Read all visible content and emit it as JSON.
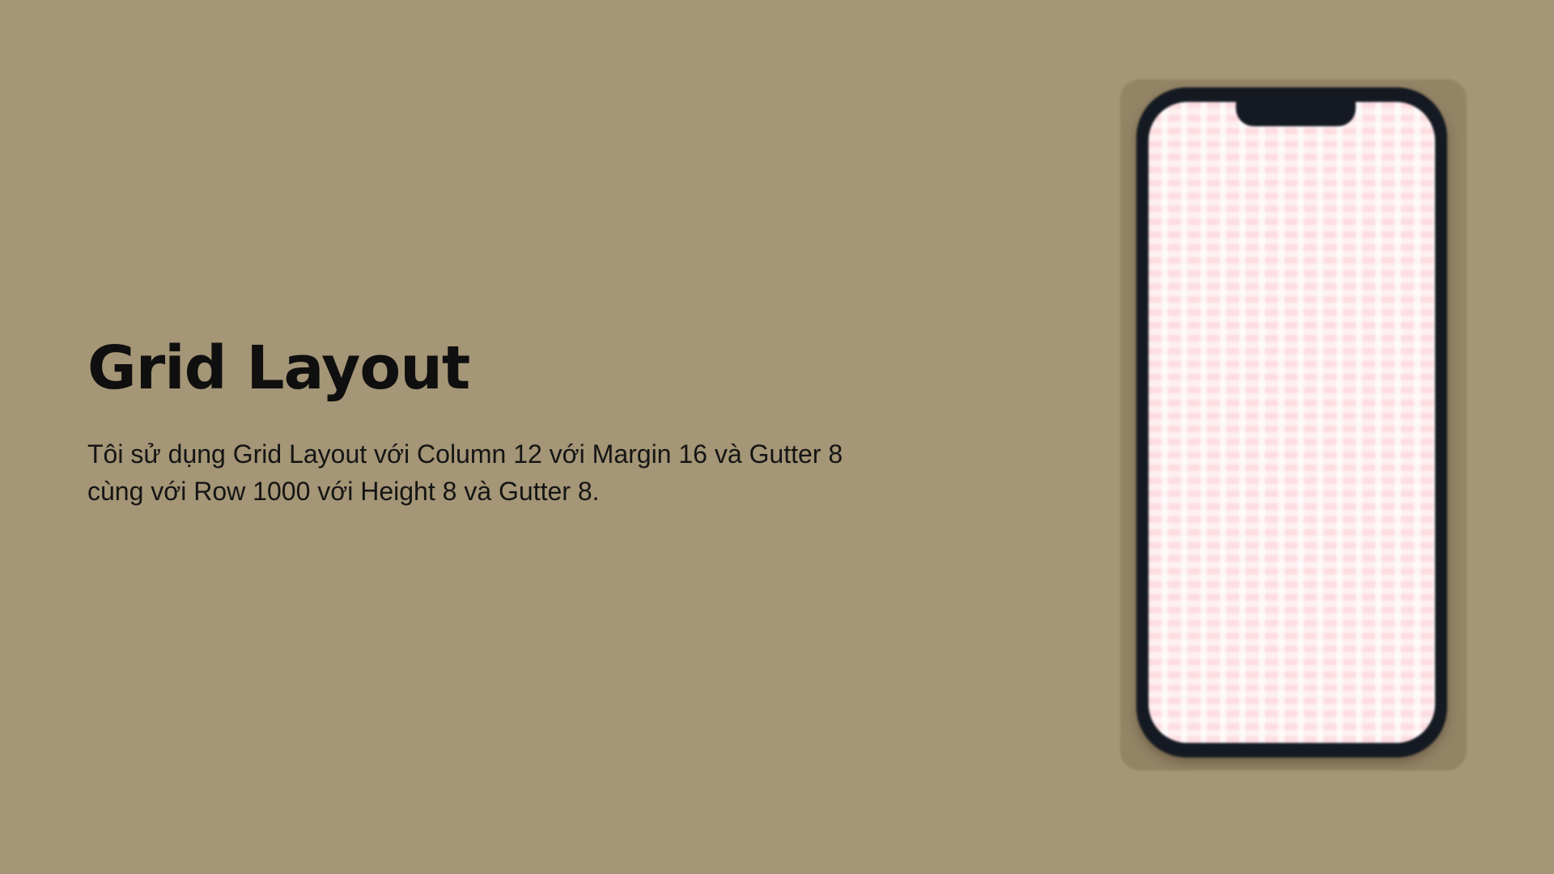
{
  "slide": {
    "title": "Grid Layout",
    "description": "Tôi sử dụng Grid Layout với Column 12 với Margin 16 và Gutter 8 cùng với Row 1000 với Height 8 và Gutter 8."
  },
  "colors": {
    "background": "#a49676",
    "phone_body": "#151a22",
    "grid_fill": "#fddde1"
  }
}
